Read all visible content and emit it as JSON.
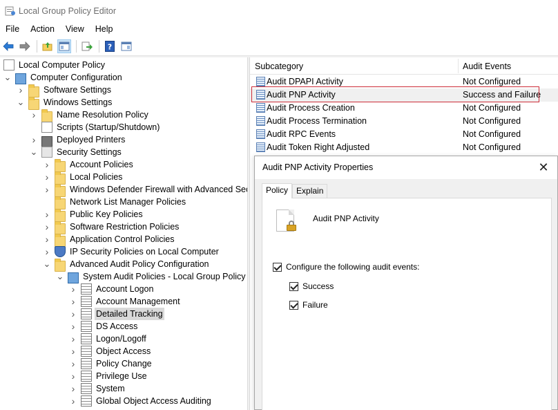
{
  "window": {
    "title": "Local Group Policy Editor"
  },
  "menu": [
    "File",
    "Action",
    "View",
    "Help"
  ],
  "tree": [
    {
      "label": "Local Computer Policy",
      "depth": 0,
      "twisty": "",
      "icon": "doc",
      "name": "tree-local-computer-policy"
    },
    {
      "label": "Computer Configuration",
      "depth": 0,
      "twisty": "expanded",
      "icon": "computer",
      "name": "tree-computer-configuration"
    },
    {
      "label": "Software Settings",
      "depth": 1,
      "twisty": "collapsed",
      "icon": "folder",
      "name": "tree-software-settings"
    },
    {
      "label": "Windows Settings",
      "depth": 1,
      "twisty": "expanded",
      "icon": "folder",
      "name": "tree-windows-settings"
    },
    {
      "label": "Name Resolution Policy",
      "depth": 2,
      "twisty": "collapsed",
      "icon": "folder",
      "name": "tree-name-resolution-policy"
    },
    {
      "label": "Scripts (Startup/Shutdown)",
      "depth": 2,
      "twisty": "",
      "icon": "doc",
      "name": "tree-scripts"
    },
    {
      "label": "Deployed Printers",
      "depth": 2,
      "twisty": "collapsed",
      "icon": "printer",
      "name": "tree-deployed-printers"
    },
    {
      "label": "Security Settings",
      "depth": 2,
      "twisty": "expanded",
      "icon": "book",
      "name": "tree-security-settings"
    },
    {
      "label": "Account Policies",
      "depth": 3,
      "twisty": "collapsed",
      "icon": "folder",
      "name": "tree-account-policies"
    },
    {
      "label": "Local Policies",
      "depth": 3,
      "twisty": "collapsed",
      "icon": "folder",
      "name": "tree-local-policies"
    },
    {
      "label": "Windows Defender Firewall with Advanced Secur",
      "depth": 3,
      "twisty": "collapsed",
      "icon": "folder",
      "name": "tree-windows-defender-firewall"
    },
    {
      "label": "Network List Manager Policies",
      "depth": 3,
      "twisty": "",
      "icon": "folder",
      "name": "tree-network-list-manager"
    },
    {
      "label": "Public Key Policies",
      "depth": 3,
      "twisty": "collapsed",
      "icon": "folder",
      "name": "tree-public-key-policies"
    },
    {
      "label": "Software Restriction Policies",
      "depth": 3,
      "twisty": "collapsed",
      "icon": "folder",
      "name": "tree-software-restriction"
    },
    {
      "label": "Application Control Policies",
      "depth": 3,
      "twisty": "collapsed",
      "icon": "folder",
      "name": "tree-application-control"
    },
    {
      "label": "IP Security Policies on Local Computer",
      "depth": 3,
      "twisty": "collapsed",
      "icon": "shield",
      "name": "tree-ip-security"
    },
    {
      "label": "Advanced Audit Policy Configuration",
      "depth": 3,
      "twisty": "expanded",
      "icon": "folder",
      "name": "tree-advanced-audit"
    },
    {
      "label": "System Audit Policies - Local Group Policy Ob",
      "depth": 4,
      "twisty": "expanded",
      "icon": "computer",
      "name": "tree-system-audit-policies"
    },
    {
      "label": "Account Logon",
      "depth": 5,
      "twisty": "collapsed",
      "icon": "policy",
      "name": "tree-account-logon"
    },
    {
      "label": "Account Management",
      "depth": 5,
      "twisty": "collapsed",
      "icon": "policy",
      "name": "tree-account-management"
    },
    {
      "label": "Detailed Tracking",
      "depth": 5,
      "twisty": "collapsed",
      "icon": "policy",
      "name": "tree-detailed-tracking",
      "selected": true
    },
    {
      "label": "DS Access",
      "depth": 5,
      "twisty": "collapsed",
      "icon": "policy",
      "name": "tree-ds-access"
    },
    {
      "label": "Logon/Logoff",
      "depth": 5,
      "twisty": "collapsed",
      "icon": "policy",
      "name": "tree-logon-logoff"
    },
    {
      "label": "Object Access",
      "depth": 5,
      "twisty": "collapsed",
      "icon": "policy",
      "name": "tree-object-access"
    },
    {
      "label": "Policy Change",
      "depth": 5,
      "twisty": "collapsed",
      "icon": "policy",
      "name": "tree-policy-change"
    },
    {
      "label": "Privilege Use",
      "depth": 5,
      "twisty": "collapsed",
      "icon": "policy",
      "name": "tree-privilege-use"
    },
    {
      "label": "System",
      "depth": 5,
      "twisty": "collapsed",
      "icon": "policy",
      "name": "tree-system"
    },
    {
      "label": "Global Object Access Auditing",
      "depth": 5,
      "twisty": "collapsed",
      "icon": "policy",
      "name": "tree-global-object-access"
    }
  ],
  "list": {
    "headers": {
      "subcategory": "Subcategory",
      "audit_events": "Audit Events"
    },
    "rows": [
      {
        "subcategory": "Audit DPAPI Activity",
        "audit_events": "Not Configured"
      },
      {
        "subcategory": "Audit PNP Activity",
        "audit_events": "Success and Failure",
        "highlight": true
      },
      {
        "subcategory": "Audit Process Creation",
        "audit_events": "Not Configured"
      },
      {
        "subcategory": "Audit Process Termination",
        "audit_events": "Not Configured"
      },
      {
        "subcategory": "Audit RPC Events",
        "audit_events": "Not Configured"
      },
      {
        "subcategory": "Audit Token Right Adjusted",
        "audit_events": "Not Configured"
      }
    ]
  },
  "dialog": {
    "title": "Audit PNP Activity Properties",
    "close_glyph": "✕",
    "tabs": [
      "Policy",
      "Explain"
    ],
    "policy_name": "Audit PNP Activity",
    "configure_label": "Configure the following audit events:",
    "configure_checked": true,
    "success_label": "Success",
    "success_checked": true,
    "failure_label": "Failure",
    "failure_checked": true
  }
}
